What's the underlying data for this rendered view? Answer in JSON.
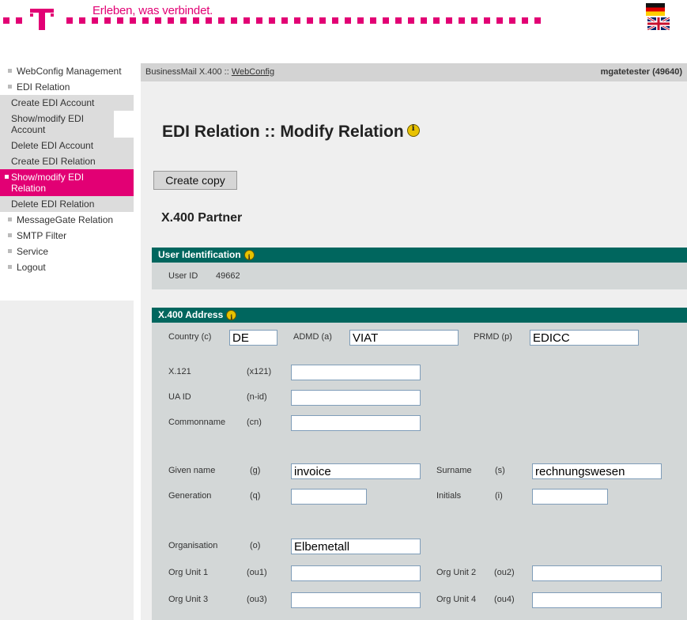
{
  "header": {
    "slogan": "Erleben, was verbindet."
  },
  "sidebar": {
    "items": [
      {
        "label": "WebConfig Management"
      },
      {
        "label": "EDI Relation"
      },
      {
        "label": "Create EDI Account"
      },
      {
        "label": "Show/modify EDI Account"
      },
      {
        "label": "Delete EDI Account"
      },
      {
        "label": "Create EDI Relation"
      },
      {
        "label": "Show/modify EDI Relation"
      },
      {
        "label": "Delete EDI Relation"
      },
      {
        "label": "MessageGate Relation"
      },
      {
        "label": "SMTP Filter"
      },
      {
        "label": "Service"
      },
      {
        "label": "Logout"
      }
    ]
  },
  "crumb": {
    "prefix": "BusinessMail X.400 :: ",
    "link": "WebConfig",
    "user": "mgatetester (49640)"
  },
  "page": {
    "title": "EDI Relation :: Modify Relation",
    "copy_button": "Create copy",
    "section": "X.400 Partner"
  },
  "user_identification": {
    "heading": "User Identification",
    "user_id_label": "User ID",
    "user_id_value": "49662"
  },
  "x400": {
    "heading": "X.400 Address",
    "country_label": "Country (c)",
    "country_value": "DE",
    "admd_label": "ADMD (a)",
    "admd_value": "VIAT",
    "prmd_label": "PRMD (p)",
    "prmd_value": "EDICC",
    "x121_label": "X.121",
    "x121_code": "(x121)",
    "x121_value": "",
    "uaid_label": "UA ID",
    "uaid_code": "(n-id)",
    "uaid_value": "",
    "cn_label": "Commonname",
    "cn_code": "(cn)",
    "cn_value": "",
    "given_label": "Given name",
    "given_code": "(g)",
    "given_value": "invoice",
    "surname_label": "Surname",
    "surname_code": "(s)",
    "surname_value": "rechnungswesen",
    "generation_label": "Generation",
    "generation_code": "(q)",
    "generation_value": "",
    "initials_label": "Initials",
    "initials_code": "(i)",
    "initials_value": "",
    "org_label": "Organisation",
    "org_code": "(o)",
    "org_value": "Elbemetall",
    "ou1_label": "Org Unit 1",
    "ou1_code": "(ou1)",
    "ou1_value": "",
    "ou2_label": "Org Unit 2",
    "ou2_code": "(ou2)",
    "ou2_value": "",
    "ou3_label": "Org Unit 3",
    "ou3_code": "(ou3)",
    "ou3_value": "",
    "ou4_label": "Org Unit 4",
    "ou4_code": "(ou4)",
    "ou4_value": ""
  },
  "colors": {
    "brand_magenta": "#e20074",
    "bar_teal": "#00665e"
  }
}
